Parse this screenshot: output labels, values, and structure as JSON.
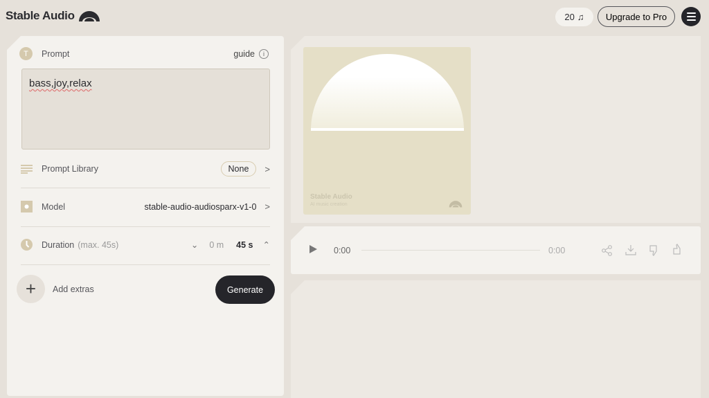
{
  "header": {
    "brand": "Stable Audio",
    "credits": "20",
    "credits_icon": "music-note-icon",
    "upgrade_label": "Upgrade to Pro",
    "menu_icon": "hamburger-menu-icon"
  },
  "prompt": {
    "label": "Prompt",
    "guide_label": "guide",
    "value": "bass,joy,relax"
  },
  "prompt_library": {
    "label": "Prompt Library",
    "value": "None"
  },
  "model": {
    "label": "Model",
    "value": "stable-audio-audiosparx-v1-0"
  },
  "duration": {
    "label": "Duration",
    "hint": "(max. 45s)",
    "minutes": "0 m",
    "seconds": "45 s"
  },
  "actions": {
    "extras_label": "Add extras",
    "generate_label": "Generate"
  },
  "cover": {
    "title": "Stable Audio",
    "subtitle": "AI music creation"
  },
  "player": {
    "current_time": "0:00",
    "total_time": "0:00",
    "progress": 0
  },
  "colors": {
    "background": "#e6e1da",
    "panel": "#f4f2ee",
    "accent": "#d5c9ad",
    "cover": "#e5dfc7",
    "button_dark": "#25252a"
  }
}
